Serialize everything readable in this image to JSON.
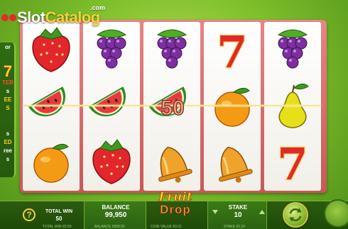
{
  "watermark": {
    "brand_a": "Slot",
    "brand_b": "Catalog",
    "tld": ".com"
  },
  "left_panel": {
    "lines": [
      "or",
      "7",
      "TER",
      "s",
      "EE",
      "S",
      "s",
      "ED",
      "ree",
      "s"
    ]
  },
  "reels": [
    [
      "strawberry",
      "watermelon",
      "orange"
    ],
    [
      "grapes",
      "watermelon",
      "strawberry"
    ],
    [
      "grapes",
      "watermelon",
      "bell"
    ],
    [
      "seven",
      "orange",
      "bell"
    ],
    [
      "grapes",
      "pear",
      "seven"
    ]
  ],
  "symbols": {
    "seven_text": "7"
  },
  "win": {
    "amount": "50"
  },
  "bottom_bar": {
    "help_label": "?",
    "total_win_label": "TOTAL WIN",
    "total_win_value": "50",
    "total_win_sub": "TOTAL WIN €0.50",
    "balance_label": "BALANCE",
    "balance_value": "99,950",
    "balance_sub": "BALANCE €999.50",
    "coin_value_sub": "COIN VALUE €0.01",
    "stake_label": "STAKE",
    "stake_value": "10",
    "stake_sub": "STAKE €0.10"
  },
  "logo": {
    "line1": "Fruit",
    "line2": "Drop"
  },
  "colors": {
    "background": "#7fc02c",
    "frame": "#d96a6a",
    "gold": "#f4d23a",
    "win_text": "#f0a07a"
  }
}
